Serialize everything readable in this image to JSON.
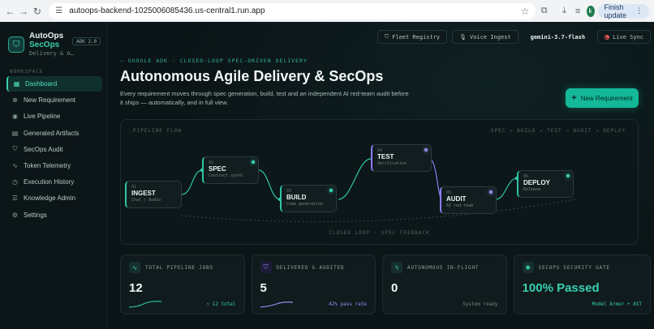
{
  "browser": {
    "url": "autoops-backend-1025006085436.us-central1.run.app",
    "finish_update": "Finish update",
    "profile_initial": "k"
  },
  "brand": {
    "name1": "AutoOps",
    "name2": "SecOps",
    "tagline": "Delivery & A…",
    "version": "ADK 2.0"
  },
  "sidebar": {
    "section": "WORKSPACE",
    "items": [
      {
        "label": "Dashboard",
        "icon": "dashboard-icon",
        "active": true
      },
      {
        "label": "New Requirement",
        "icon": "plus-circle-icon"
      },
      {
        "label": "Live Pipeline",
        "icon": "play-circle-icon"
      },
      {
        "label": "Generated Artifacts",
        "icon": "file-icon"
      },
      {
        "label": "SecOps Audit",
        "icon": "shield-icon"
      },
      {
        "label": "Token Telemetry",
        "icon": "pulse-icon"
      },
      {
        "label": "Execution History",
        "icon": "history-icon"
      },
      {
        "label": "Knowledge Admin",
        "icon": "database-icon"
      },
      {
        "label": "Settings",
        "icon": "gear-icon"
      }
    ]
  },
  "topbar": {
    "fleet": "Fleet Registry",
    "voice": "Voice Ingest",
    "model": "gemini-3.7-flash",
    "live": "Live Sync"
  },
  "hero": {
    "eyebrow": "— GOOGLE ADK · CLOSED-LOOP SPEC-DRIVEN DELIVERY",
    "title": "Autonomous Agile Delivery & SecOps",
    "subtitle": "Every requirement moves through spec generation, build, test and an independent AI red-team audit before it ships — automatically, and in full view.",
    "cta": "New Requirement"
  },
  "pipeline": {
    "label": "PIPELINE FLOW",
    "stages_label": "SPEC → BUILD → TEST → AUDIT → DEPLOY",
    "footer": "CLOSED LOOP · SPEC FEEDBACK",
    "stages": [
      {
        "num": "01",
        "name": "INGEST",
        "desc": "Chat / Audio",
        "color": "teal"
      },
      {
        "num": "02",
        "name": "SPEC",
        "desc": "Contract synth",
        "color": "teal"
      },
      {
        "num": "03",
        "name": "BUILD",
        "desc": "Code generation",
        "color": "teal"
      },
      {
        "num": "04",
        "name": "TEST",
        "desc": "Verification",
        "color": "purple"
      },
      {
        "num": "05",
        "name": "AUDIT",
        "desc": "AI red-team",
        "color": "purple"
      },
      {
        "num": "06",
        "name": "DEPLOY",
        "desc": "Release",
        "color": "teal"
      }
    ]
  },
  "stats": [
    {
      "label": "TOTAL PIPELINE JOBS",
      "value": "12",
      "foot": "↑ 12 total",
      "icon": "pulse-icon",
      "accent": "teal"
    },
    {
      "label": "DELIVERED & AUDITED",
      "value": "5",
      "foot": "42% pass rate",
      "icon": "shield-icon",
      "accent": "purple"
    },
    {
      "label": "AUTONOMOUS IN-FLIGHT",
      "value": "0",
      "foot": "System ready",
      "icon": "bolt-icon",
      "accent": "muted"
    },
    {
      "label": "SECOPS SECURITY GATE",
      "value": "100% Passed",
      "foot": "Model Armor + AST",
      "icon": "lock-icon",
      "accent": "green"
    }
  ],
  "colors": {
    "accent": "#14b899",
    "purple": "#9a8cf5",
    "bg": "#0b1416"
  }
}
